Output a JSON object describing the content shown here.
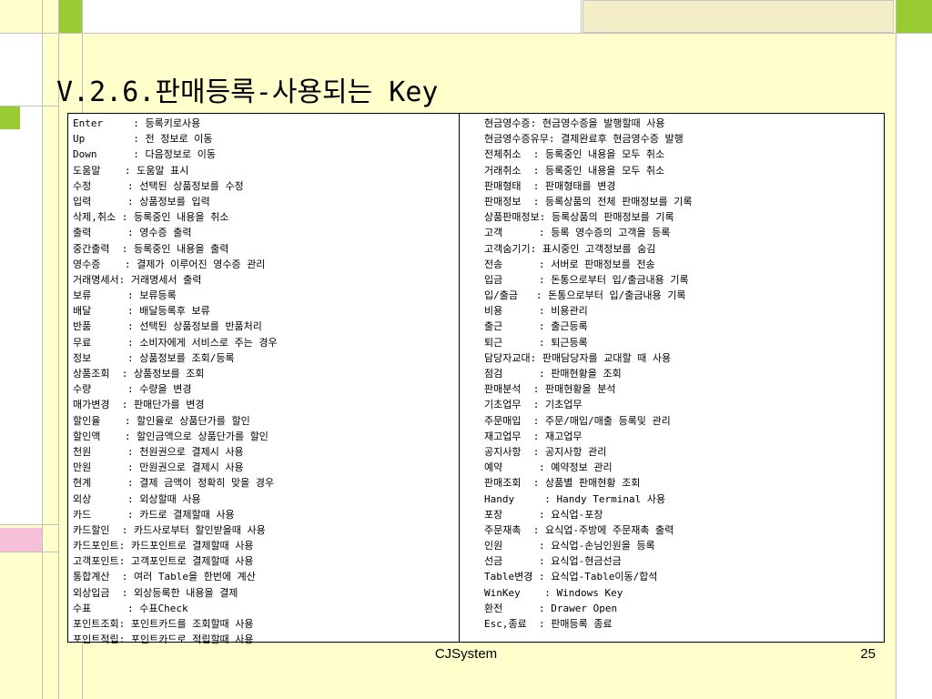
{
  "slide": {
    "title": "V.2.6.판매등록-사용되는 Key",
    "footer": "CJSystem",
    "page_number": "25"
  },
  "left_keys": [
    {
      "key": "Enter",
      "desc": "등록키로사용"
    },
    {
      "key": "Up",
      "desc": "전 정보로 이동"
    },
    {
      "key": "Down",
      "desc": "다음정보로 이동"
    },
    {
      "key": "도움말",
      "desc": "도움말 표시"
    },
    {
      "key": "수정",
      "desc": "선택된 상품정보를 수정"
    },
    {
      "key": "입력",
      "desc": "상품정보를 입력"
    },
    {
      "key": "삭제,취소",
      "desc": "등록중인 내용을 취소"
    },
    {
      "key": "출력",
      "desc": "영수증 출력"
    },
    {
      "key": "중간출력",
      "desc": "등록중인 내용을 출력"
    },
    {
      "key": "영수증",
      "desc": "결제가 이루어진 영수증 관리"
    },
    {
      "key": "거래명세서",
      "desc": "거래명세서 출력"
    },
    {
      "key": "보류",
      "desc": "보류등록"
    },
    {
      "key": "배달",
      "desc": "배달등록후 보류"
    },
    {
      "key": "반품",
      "desc": "선택된 상품정보를 반품처리"
    },
    {
      "key": "무료",
      "desc": "소비자에게 서비스로 주는 경우"
    },
    {
      "key": "정보",
      "desc": "상품정보를 조회/등록"
    },
    {
      "key": "상품조회",
      "desc": "상품정보를 조회"
    },
    {
      "key": "수량",
      "desc": "수량을 변경"
    },
    {
      "key": "매가변경",
      "desc": "판매단가를 변경"
    },
    {
      "key": "할인율",
      "desc": "할인율로 상품단가를 할인"
    },
    {
      "key": "할인액",
      "desc": "할인금액으로 상품단가를 할인"
    },
    {
      "key": "천원",
      "desc": "천원권으로 결제시 사용"
    },
    {
      "key": "만원",
      "desc": "만원권으로 결제시 사용"
    },
    {
      "key": "현계",
      "desc": "결제 금액이 정확히 맞을 경우"
    },
    {
      "key": "외상",
      "desc": "외상할때 사용"
    },
    {
      "key": "카드",
      "desc": "카드로 결제할때 사용"
    },
    {
      "key": "카드할인",
      "desc": "카드사로부터 할인받을때 사용"
    },
    {
      "key": "카드포인트",
      "desc": "카드포인트로 결제할때 사용"
    },
    {
      "key": "고객포인트",
      "desc": "고객포인트로 결제할때 사용"
    },
    {
      "key": "통합계산",
      "desc": "여러 Table을 한번에 계산"
    },
    {
      "key": "외상입금",
      "desc": "외상등록한 내용을 결제"
    },
    {
      "key": "수표",
      "desc": "수표Check"
    },
    {
      "key": "포인트조회",
      "desc": "포인트카드를 조회할때 사용"
    },
    {
      "key": "포인트적립",
      "desc": "포인트카드로 적립할때 사용"
    }
  ],
  "right_keys": [
    {
      "key": "현금영수증",
      "desc": "현금영수증을 발행할때 사용"
    },
    {
      "key": "현금영수증유무",
      "desc": "결제완료후 현금영수증 발행"
    },
    {
      "key": "전체취소",
      "desc": "등록중인 내용을 모두 취소"
    },
    {
      "key": "거래취소",
      "desc": "등록중인 내용을 모두 취소"
    },
    {
      "key": "판매형태",
      "desc": "판매형태를 변경"
    },
    {
      "key": "판매정보",
      "desc": "등록상품의 전체 판매정보를 기록"
    },
    {
      "key": "상품판매정보",
      "desc": "등록상품의 판매정보를 기록"
    },
    {
      "key": "고객",
      "desc": "등록 영수증의 고객을 등록"
    },
    {
      "key": "고객숨기기",
      "desc": "표시중인 고객정보를 숨김"
    },
    {
      "key": "전송",
      "desc": "서버로 판매정보를 전송"
    },
    {
      "key": "입금",
      "desc": "돈통으로부터 입/출금내용 기록"
    },
    {
      "key": "입/출금",
      "desc": "돈통으로부터 입/출금내용 기록"
    },
    {
      "key": "비용",
      "desc": "비용관리"
    },
    {
      "key": "출근",
      "desc": "출근등록"
    },
    {
      "key": "퇴근",
      "desc": "퇴근등록"
    },
    {
      "key": "담당자교대",
      "desc": "판매담당자를 교대할 때 사용"
    },
    {
      "key": "점검",
      "desc": "판매현황을 조회"
    },
    {
      "key": "판매분석",
      "desc": "판매현황을 분석"
    },
    {
      "key": "기초업무",
      "desc": "기초업무"
    },
    {
      "key": "주문매입",
      "desc": "주문/매입/매출 등록및 관리"
    },
    {
      "key": "재고업무",
      "desc": "재고업무"
    },
    {
      "key": "공지사항",
      "desc": "공지사항 관리"
    },
    {
      "key": "예약",
      "desc": "예약정보 관리"
    },
    {
      "key": "판매조회",
      "desc": "상품별 판매현황 조회"
    },
    {
      "key": "Handy",
      "desc": "Handy Terminal 사용"
    },
    {
      "key": "포장",
      "desc": "요식업-포장"
    },
    {
      "key": "주문재촉",
      "desc": "요식업-주방에 주문재촉 출력"
    },
    {
      "key": "인원",
      "desc": "요식업-손님인원을 등록"
    },
    {
      "key": "선금",
      "desc": "요식업-현금선금"
    },
    {
      "key": "Table변경",
      "desc": "요식업-Table이동/합석"
    },
    {
      "key": "WinKey",
      "desc": "Windows Key"
    },
    {
      "key": "환전",
      "desc": "Drawer Open"
    },
    {
      "key": "Esc,종료",
      "desc": "판매등록 종료"
    }
  ]
}
